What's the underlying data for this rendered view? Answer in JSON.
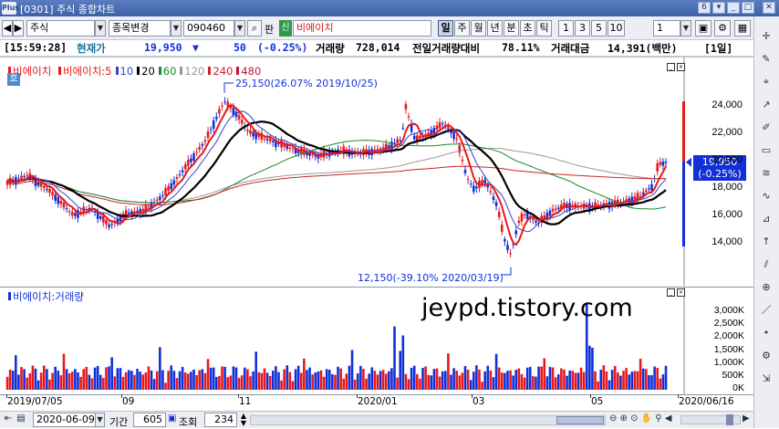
{
  "window": {
    "title": "[0301] 주식 종합차트",
    "logo": "Plus",
    "btn_num": "6"
  },
  "toolbar": {
    "nav_left": "◀",
    "nav_right": "▶",
    "market": "주식",
    "code_change": "종목변경",
    "code": "090460",
    "search_label": "판",
    "credit_badge": "신",
    "stock_name": "비에이치",
    "periods": [
      "일",
      "주",
      "월",
      "년",
      "분",
      "초",
      "틱"
    ],
    "selected_period": "일",
    "nums": [
      "1",
      "3",
      "5",
      "10"
    ],
    "count": "1"
  },
  "info": {
    "time": "[15:59:28]",
    "price_label": "현재가",
    "price": "19,950",
    "change_arrow": "▼",
    "change": "50",
    "change_pct": "(-0.25%)",
    "volume_label": "거래량",
    "volume": "728,014",
    "prev_ratio_label": "전일거래량대비",
    "prev_ratio": "78.11%",
    "amount_label": "거래대금",
    "amount": "14,391(백만)",
    "period_tag": "[1일]"
  },
  "price_pane": {
    "legend_stock": "비에이치",
    "legend_items": [
      {
        "label": "비에이치:5",
        "color": "#e8191b"
      },
      {
        "label": "10",
        "color": "#3344cc"
      },
      {
        "label": "20",
        "color": "#000000"
      },
      {
        "label": "60",
        "color": "#1a8a2a"
      },
      {
        "label": "120",
        "color": "#999999"
      },
      {
        "label": "240",
        "color": "#cc2222"
      },
      {
        "label": "480",
        "color": "#c0143c"
      }
    ],
    "side_tag": "호",
    "high_note": "25,150(26.07% 2019/10/25)",
    "low_note": "12,150(-39.10% 2020/03/19)",
    "current_label": "19,950",
    "current_pct": "(-0.25%)",
    "y_ticks": [
      "24,000",
      "22,000",
      "20,000",
      "18,000",
      "16,000",
      "14,000"
    ],
    "y_tick_values": [
      24000,
      22000,
      20000,
      18000,
      16000,
      14000
    ]
  },
  "volume_pane": {
    "legend": "비에이치:거래량",
    "watermark": "jeypd.tistory.com",
    "y_ticks": [
      "3,000K",
      "2,500K",
      "2,000K",
      "1,500K",
      "1,000K",
      "500K",
      "0K"
    ],
    "y_tick_values": [
      3000,
      2500,
      2000,
      1500,
      1000,
      500,
      0
    ]
  },
  "xaxis": {
    "labels": [
      "2019/07/05",
      "09",
      "11",
      "2020/01",
      "03",
      "05",
      "2020/06/16"
    ]
  },
  "bottom": {
    "date": "2020-06-09",
    "period_label": "기간",
    "period_value": "605",
    "view_label": "조회",
    "view_value": "234"
  },
  "colors": {
    "up": "#e8191b",
    "down": "#1230d8",
    "title_bg": "#4a6db5",
    "accent": "#1c3a78"
  },
  "sidebar_icons": [
    "cross-icon",
    "tool-icon",
    "crosshair-icon",
    "trend-icon",
    "pen-icon",
    "box-icon",
    "fib-icon",
    "wave-icon",
    "gann-icon",
    "arrow-up-icon",
    "channel-icon",
    "zoom-icon",
    "line-icon",
    "dot-icon",
    "settings-icon",
    "export-icon"
  ]
}
